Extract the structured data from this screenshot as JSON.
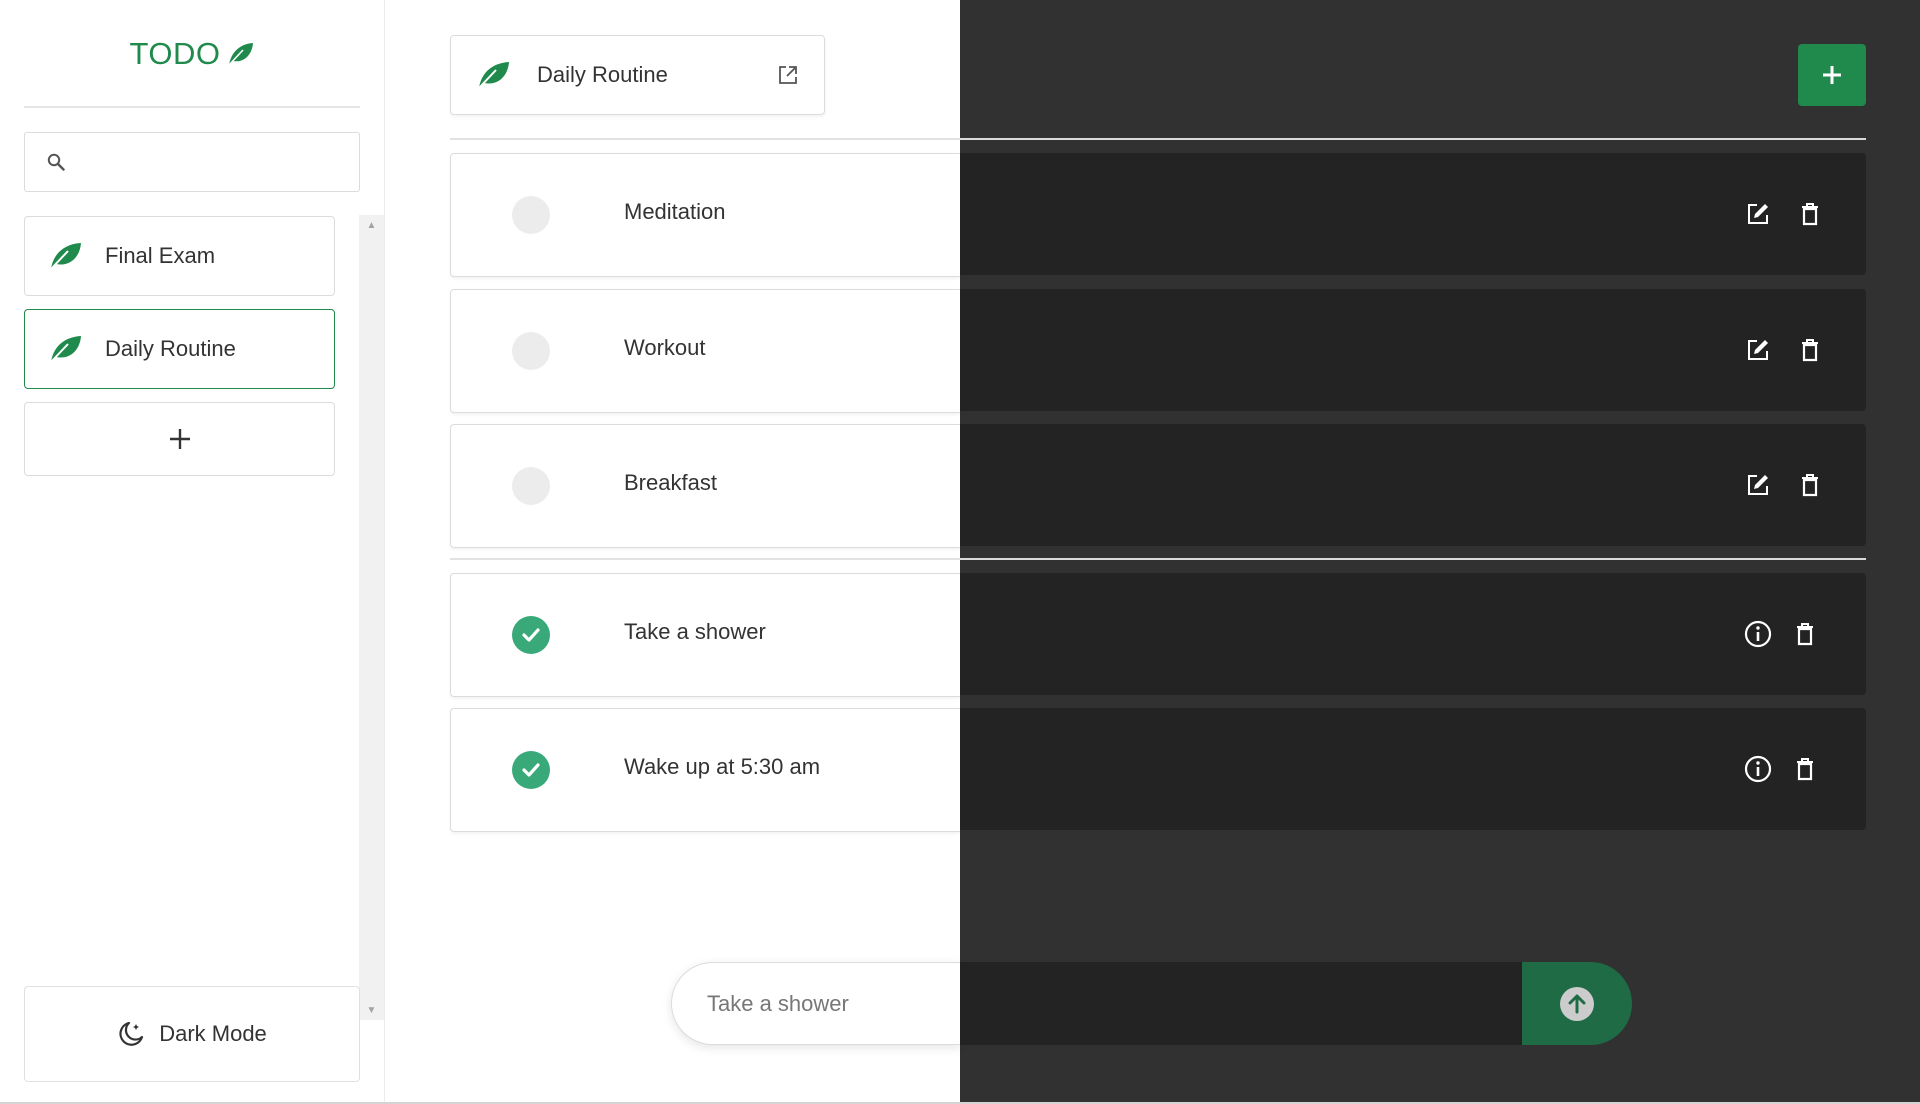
{
  "app": {
    "logo_text": "TODO"
  },
  "sidebar": {
    "search": {
      "placeholder": "",
      "value": ""
    },
    "lists": [
      {
        "label": "Final Exam",
        "active": false
      },
      {
        "label": "Daily Routine",
        "active": true
      }
    ],
    "dark_mode_label": "Dark Mode"
  },
  "main": {
    "list_title": "Daily Routine",
    "pending_tasks": [
      {
        "label": "Meditation",
        "done": false
      },
      {
        "label": "Workout",
        "done": false
      },
      {
        "label": "Breakfast",
        "done": false
      }
    ],
    "completed_tasks": [
      {
        "label": "Take a shower",
        "done": true
      },
      {
        "label": "Wake up at 5:30 am",
        "done": true
      }
    ],
    "new_task_input": {
      "placeholder": "Take a shower",
      "value": ""
    }
  },
  "colors": {
    "accent": "#1f8a4c",
    "done": "#3aa97a",
    "dark_bg": "#313131",
    "dark_card": "#232323"
  }
}
